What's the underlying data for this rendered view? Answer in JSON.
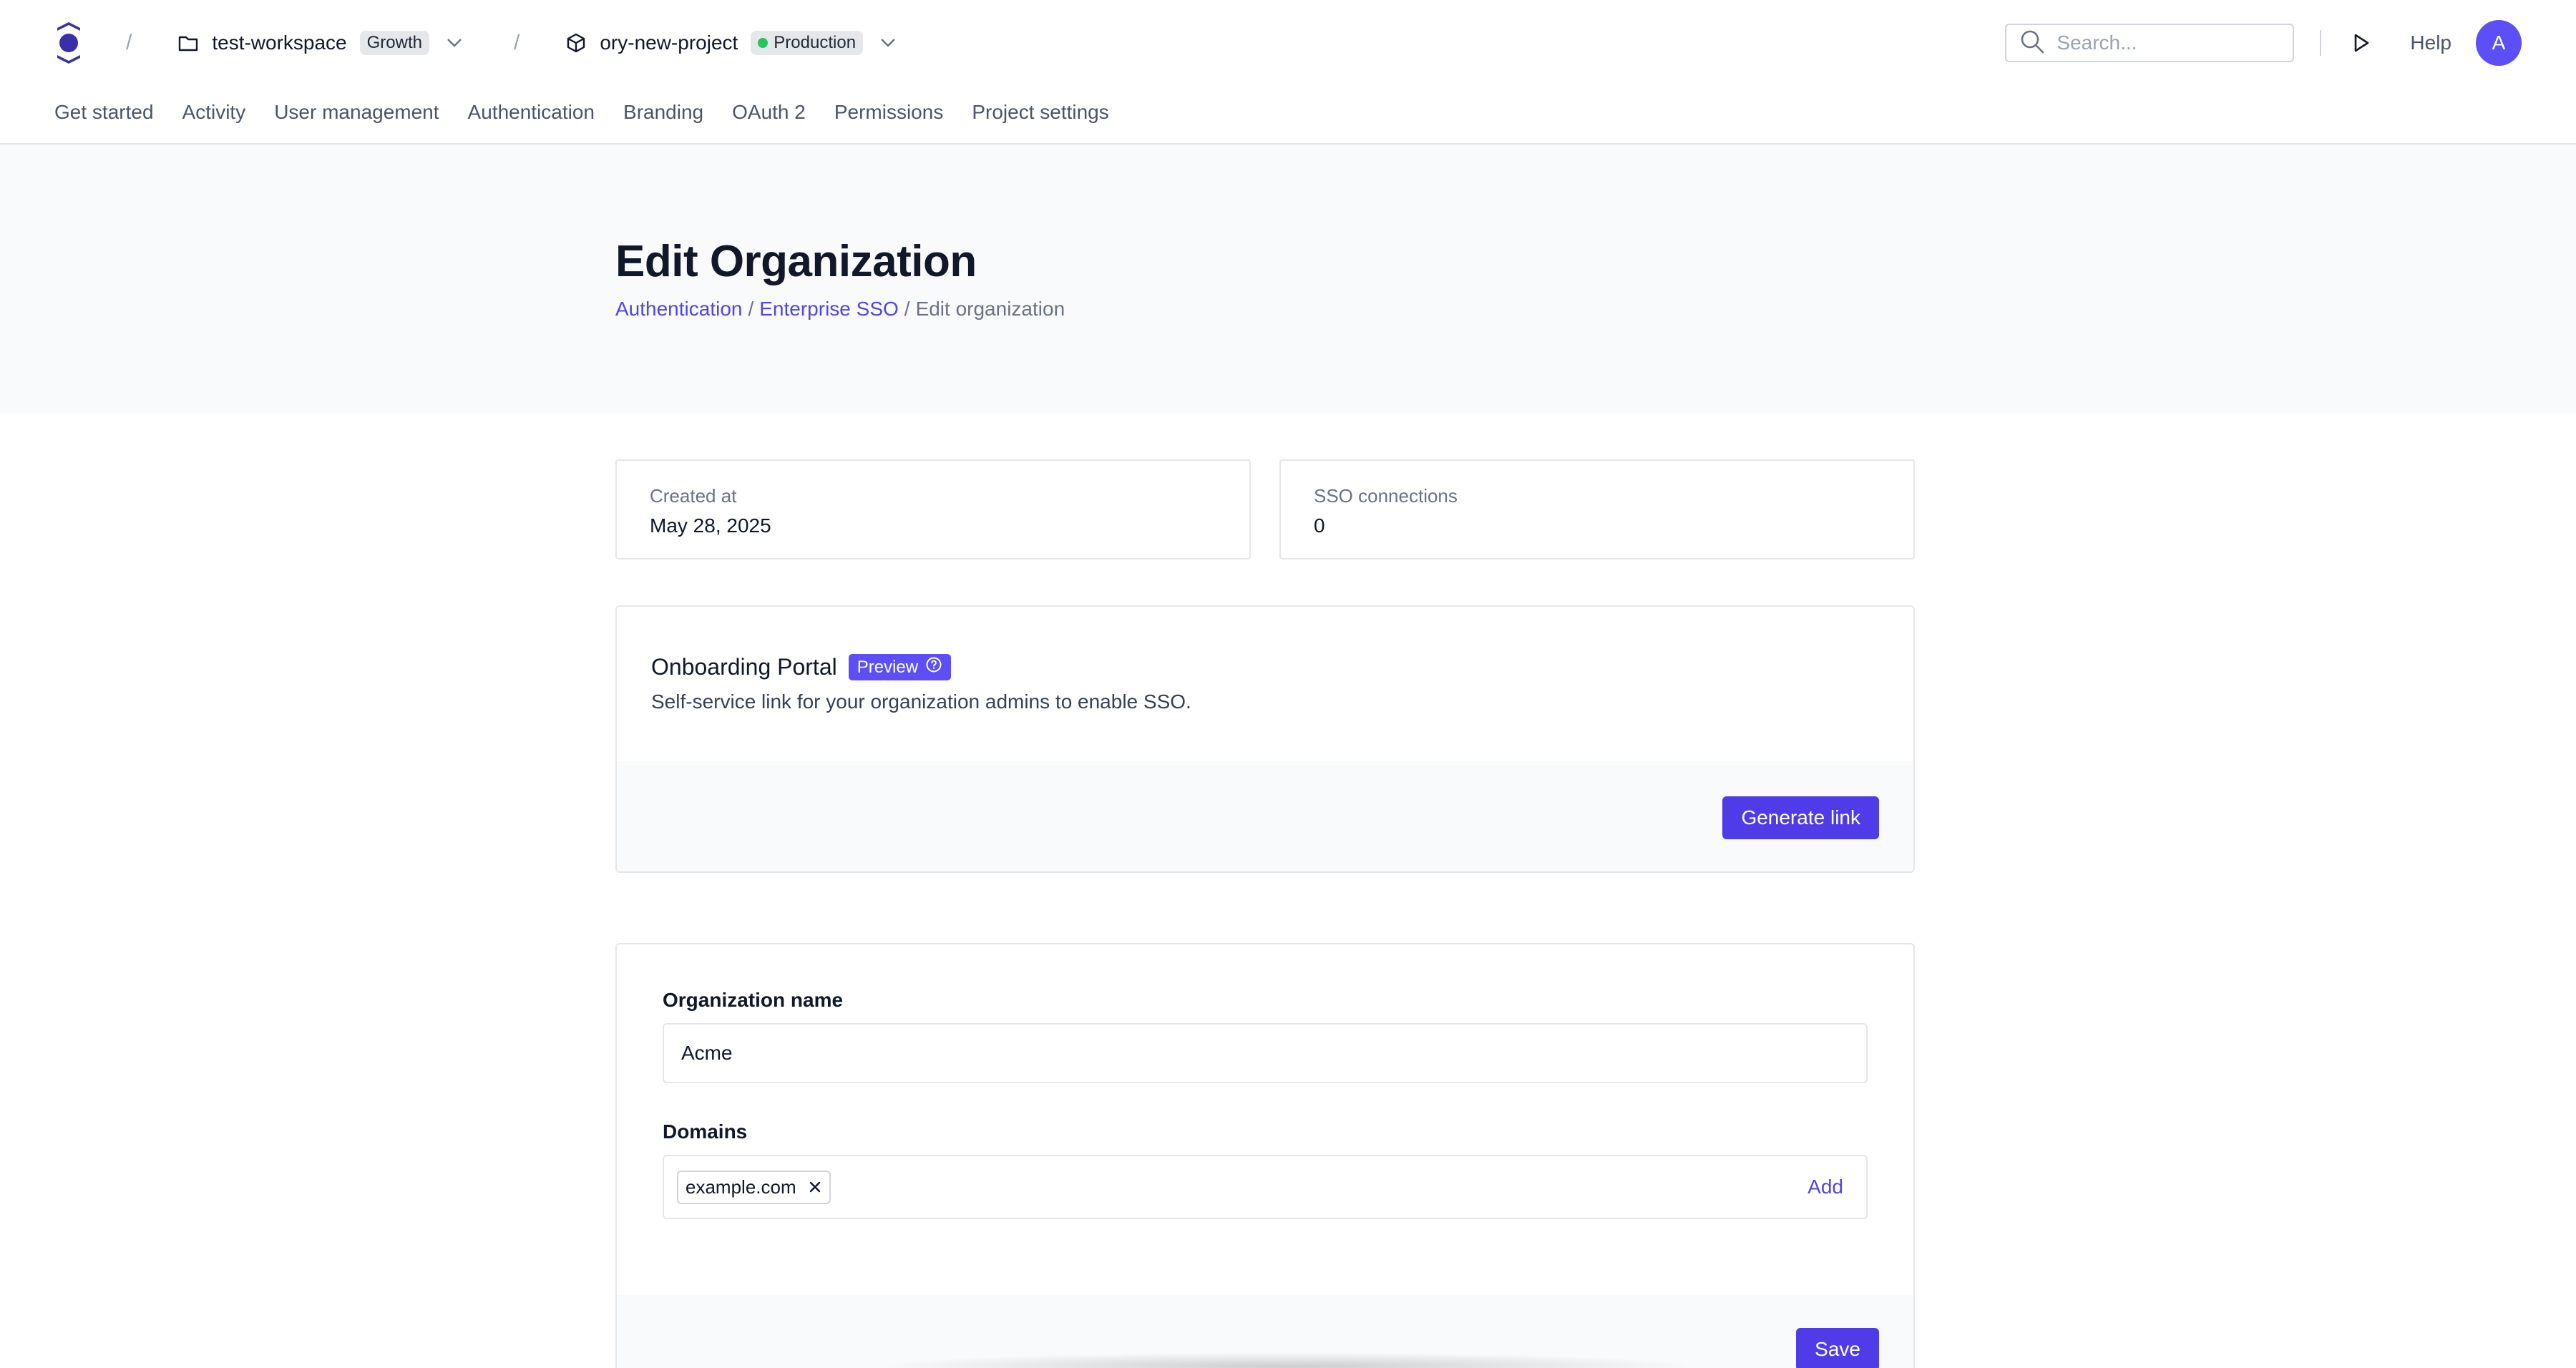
{
  "topbar": {
    "workspace": {
      "name": "test-workspace",
      "plan": "Growth"
    },
    "project": {
      "name": "ory-new-project",
      "environment": "Production",
      "environment_color": "#22c55e"
    },
    "search": {
      "placeholder": "Search..."
    },
    "help_label": "Help",
    "avatar_initial": "A"
  },
  "nav": {
    "items": [
      {
        "label": "Get started"
      },
      {
        "label": "Activity"
      },
      {
        "label": "User management"
      },
      {
        "label": "Authentication"
      },
      {
        "label": "Branding"
      },
      {
        "label": "OAuth 2"
      },
      {
        "label": "Permissions"
      },
      {
        "label": "Project settings"
      }
    ]
  },
  "header": {
    "title": "Edit Organization",
    "breadcrumb": {
      "first": "Authentication",
      "second": "Enterprise SSO",
      "current": "Edit organization",
      "separator": "/"
    }
  },
  "stats": {
    "created": {
      "label": "Created at",
      "value": "May 28, 2025"
    },
    "sso": {
      "label": "SSO connections",
      "value": "0"
    }
  },
  "portal": {
    "title": "Onboarding Portal",
    "badge": "Preview",
    "description": "Self-service link for your organization admins to enable SSO.",
    "button": "Generate link"
  },
  "form": {
    "name_label": "Organization name",
    "name_value": "Acme",
    "domains_label": "Domains",
    "domains": [
      "example.com"
    ],
    "add_label": "Add",
    "save_label": "Save"
  },
  "colors": {
    "accent": "#4f3ce8",
    "link": "#4f46e5",
    "avatar": "#5b4ff5"
  },
  "icons": {
    "logo": "ory-logo-icon",
    "workspace": "folder-icon",
    "project": "cube-icon",
    "search": "search-icon",
    "play": "play-icon"
  }
}
